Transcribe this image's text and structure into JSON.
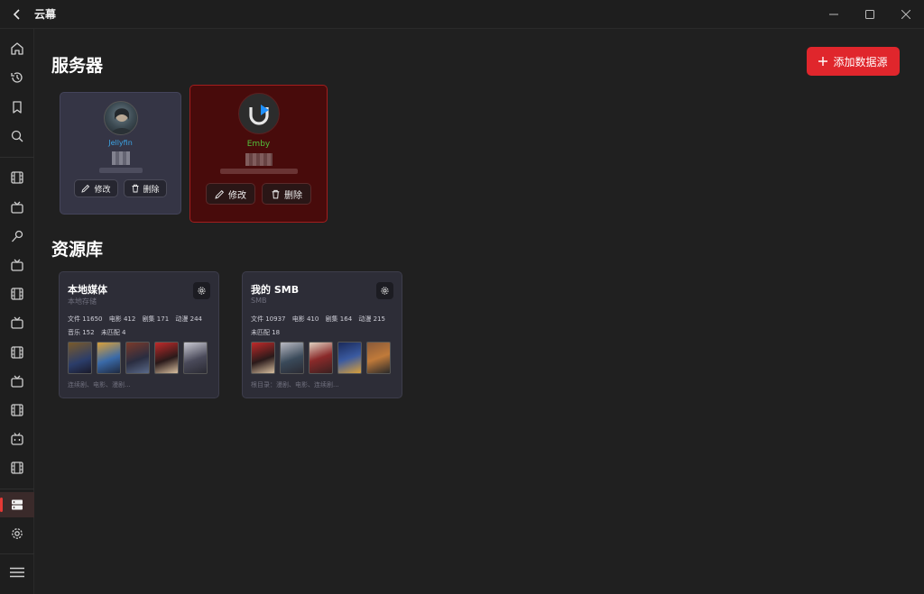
{
  "window": {
    "title": "云幕"
  },
  "sections": {
    "servers_title": "服务器",
    "libraries_title": "资源库"
  },
  "add_source_label": "添加数据源",
  "servers": [
    {
      "name": "Jellyfin",
      "edit_label": "修改",
      "delete_label": "删除",
      "accent": "#3ca5e6"
    },
    {
      "name": "Emby",
      "edit_label": "修改",
      "delete_label": "删除",
      "accent": "#52c03b"
    }
  ],
  "libraries": [
    {
      "title": "本地媒体",
      "subtitle": "本地存储",
      "stats": [
        "文件 11650",
        "电影 412",
        "剧集 171",
        "动漫 244",
        "音乐 152",
        "未匹配 4"
      ],
      "footer": "连续剧、电影、漫剧..."
    },
    {
      "title": "我的 SMB",
      "subtitle": "SMB",
      "stats": [
        "文件 10937",
        "电影 410",
        "剧集 164",
        "动漫 215",
        "未匹配 18"
      ],
      "footer": "根目录：漫剧、电影、连续剧..."
    }
  ],
  "colors": {
    "accent_red": "#e0262c",
    "background": "#202020"
  },
  "sidebar_icons": [
    "home-icon",
    "history-icon",
    "bookmark-icon",
    "search-icon",
    "film-icon",
    "tv-icon",
    "microphone-icon",
    "tv-icon",
    "film-icon",
    "tv-icon",
    "film-icon",
    "tv-icon",
    "film-icon",
    "bilibili-icon",
    "film-icon",
    "server-icon",
    "gear-icon",
    "menu-icon"
  ]
}
